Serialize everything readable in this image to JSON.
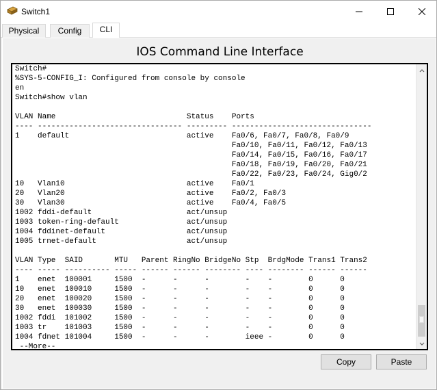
{
  "window": {
    "title": "Switch1",
    "icon": "switch-device-icon",
    "controls": [
      "minimize-icon",
      "maximize-icon",
      "close-icon"
    ]
  },
  "tabs": [
    {
      "label": "Physical",
      "selected": false
    },
    {
      "label": "Config",
      "selected": false
    },
    {
      "label": "CLI",
      "selected": true
    }
  ],
  "cli": {
    "heading": "IOS Command Line Interface",
    "terminal_text": "Switch#\n%SYS-5-CONFIG_I: Configured from console by console\nen\nSwitch#show vlan\n\nVLAN Name                             Status    Ports\n---- -------------------------------- --------- -------------------------------\n1    default                          active    Fa0/6, Fa0/7, Fa0/8, Fa0/9\n                                                Fa0/10, Fa0/11, Fa0/12, Fa0/13\n                                                Fa0/14, Fa0/15, Fa0/16, Fa0/17\n                                                Fa0/18, Fa0/19, Fa0/20, Fa0/21\n                                                Fa0/22, Fa0/23, Fa0/24, Gig0/2\n10   Vlan10                           active    Fa0/1\n20   Vlan20                           active    Fa0/2, Fa0/3\n30   Vlan30                           active    Fa0/4, Fa0/5\n1002 fddi-default                     act/unsup\n1003 token-ring-default               act/unsup\n1004 fddinet-default                  act/unsup\n1005 trnet-default                    act/unsup\n\nVLAN Type  SAID       MTU   Parent RingNo BridgeNo Stp  BrdgMode Trans1 Trans2\n---- ----- ---------- ----- ------ ------ -------- ---- -------- ------ ------\n1    enet  100001     1500  -      -      -        -    -        0      0\n10   enet  100010     1500  -      -      -        -    -        0      0\n20   enet  100020     1500  -      -      -        -    -        0      0\n30   enet  100030     1500  -      -      -        -    -        0      0\n1002 fddi  101002     1500  -      -      -        -    -        0      0\n1003 tr    101003     1500  -      -      -        -    -        0      0\n1004 fdnet 101004     1500  -      -      -        ieee -        0      0\n --More--"
  },
  "buttons": {
    "copy": "Copy",
    "paste": "Paste"
  }
}
